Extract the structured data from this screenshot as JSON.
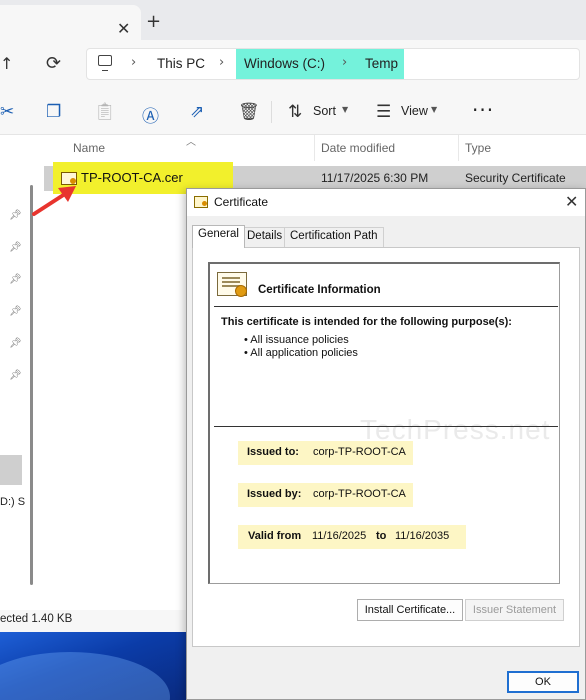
{
  "explorer": {
    "tab_close": "✕",
    "tab_add": "+",
    "breadcrumb": [
      "This PC",
      "Windows (C:)",
      "Temp"
    ],
    "toolbar": {
      "sort_label": "Sort",
      "view_label": "View",
      "more": "···"
    },
    "columns": {
      "name": "Name",
      "date": "Date modified",
      "type": "Type"
    },
    "file": {
      "name": "TP-ROOT-CA.cer",
      "date": "11/17/2025 6:30 PM",
      "type": "Security Certificate"
    },
    "nav_drive_label": "D:) S",
    "status": "ected  1.40 KB"
  },
  "dialog": {
    "title": "Certificate",
    "close": "✕",
    "tabs": [
      "General",
      "Details",
      "Certification Path"
    ],
    "info_title": "Certificate Information",
    "purpose_text": "This certificate is intended for the following purpose(s):",
    "purposes": [
      "• All issuance policies",
      "• All application policies"
    ],
    "watermark": "TechPress.net",
    "issued_to_label": "Issued to:",
    "issued_to": "corp-TP-ROOT-CA",
    "issued_by_label": "Issued by:",
    "issued_by": "corp-TP-ROOT-CA",
    "valid_from_label": "Valid from",
    "valid_from": "11/16/2025",
    "valid_to_label": "to",
    "valid_to": "11/16/2035",
    "install_button": "Install Certificate...",
    "issuer_statement_button": "Issuer Statement",
    "ok_button": "OK"
  },
  "colors": {
    "breadcrumb_highlight": "#74f2db",
    "file_highlight": "#f2f02c",
    "field_highlight": "#fdf6c5",
    "arrow": "#e8342e"
  }
}
